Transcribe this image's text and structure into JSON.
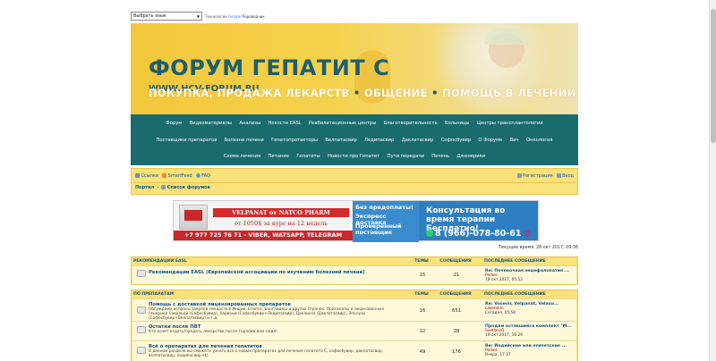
{
  "translate": {
    "select_value": "Выбрать язык",
    "powered_text": "Технологии",
    "google": "Google",
    "translator": "Переводчик"
  },
  "banner": {
    "title": "ФОРУМ ГЕПАТИТ С",
    "url": "WWW.HCV-FORUM.RU",
    "slogan_1": "ПОКУПКА, ПРОДАЖА ЛЕКАРСТВ",
    "slogan_2": "ОБЩЕНИЕ",
    "slogan_3": "ПОМОЩЬ В ЛЕЧЕНИИ"
  },
  "main_nav": {
    "row1": [
      "Форум",
      "Видеоматериалы",
      "Анализы",
      "Новости EASL",
      "Реабилитационные центры",
      "Благотворительность",
      "Больницы",
      "Центры трансплантологии"
    ],
    "row2": [
      "Поставщики препаратов",
      "Болезни печени",
      "Гепатопротекторы",
      "Велпатасвир",
      "Ледипасвир",
      "Даклатасвир",
      "Софосбувир",
      "О Форуме",
      "Вич",
      "Онкология"
    ],
    "row3": [
      "Схема лечения",
      "Питание",
      "Гепатиты",
      "Новости про Гепатит",
      "Пути передачи",
      "Печень",
      "Дженерики"
    ]
  },
  "navbar": {
    "links_left": [
      "Ссылки",
      "SmartFeed",
      "FAQ"
    ],
    "register": "Регистрация",
    "login": "Вход",
    "breadcrumb_home": "Портал",
    "breadcrumb_forums": "Список форумов"
  },
  "ad": {
    "title": "VELPANAT от NATCO PHARM",
    "price": "от 1050$ за курс на 12 недель",
    "phone_left": "+7 977 725 76 71 - VIBER, WATSAPP, TELEGRAM",
    "tag1": "Без предоплаты!",
    "tag2": "Экспресс доставка",
    "tag3": "Проверенный",
    "tag4": "поставщик",
    "consult": "Консультация во время терапии Бесплатно!",
    "phone_right": "8 (966)-078-80-61"
  },
  "server_time": "Текущее время: 28 окт 2017, 09:36",
  "forum1": {
    "header": {
      "title": "Рекомендации EASL",
      "topics": "Темы",
      "posts": "Сообщения",
      "last": "Последнее сообщение"
    },
    "rows": [
      {
        "title": "Рекомендации EASL (Европейской ассоциации по изучению болезней печени)",
        "desc": "",
        "topics": "15",
        "posts": "21",
        "last_title": "Re: Печеночная энцефалопатия ...",
        "last_author": "Perker",
        "last_date": "18 окт 2017, 05:52"
      }
    ]
  },
  "forum2": {
    "header": {
      "title": "По препаратам",
      "topics": "Темы",
      "posts": "Сообщения",
      "last": "Последнее сообщение"
    },
    "rows": [
      {
        "title": "Помощь с доставкой лицензированных препаратов",
        "desc": "Обсуждаем вопросы закупки лекарств в Индии, Египте, Бангладеш и других странах. Оригиналы и лицензионные генерики Совальди (Софосбувир), Харвони (Софосбувир+Ледипасвир), Даклинза (Даклатасвир), Эпклуза (Софосбувир+Велпатасвир) и т.д.",
        "topics": "16",
        "posts": "651",
        "last_title": "Re: Vosevir, Velpanat, Velaxo...",
        "last_author": "Lakomkin",
        "last_date": "Сегодня, 05:58"
      },
      {
        "title": "Остатки после ПВТ",
        "desc": "Кто хочет отдать/продать лекарства после терапии вам сюда!",
        "topics": "12",
        "posts": "28",
        "last_title": "Продам оставшийся комплект \"М...",
        "last_author": "Svetlana1",
        "last_date": "19 окт 2017, 16:29"
      },
      {
        "title": "Всё о препаратах для лечения гепатитов",
        "desc": "В данном разделе вы сможете узнать все о новых препаратах для лечения гепатита С, софосбувир, даклатасвир, велпатасвир, ледипасвир etc.",
        "topics": "49",
        "posts": "176",
        "last_title": "Re: Индийские или египетские ...",
        "last_author": "Perker",
        "last_date": "Вчера, 17:17"
      }
    ]
  }
}
